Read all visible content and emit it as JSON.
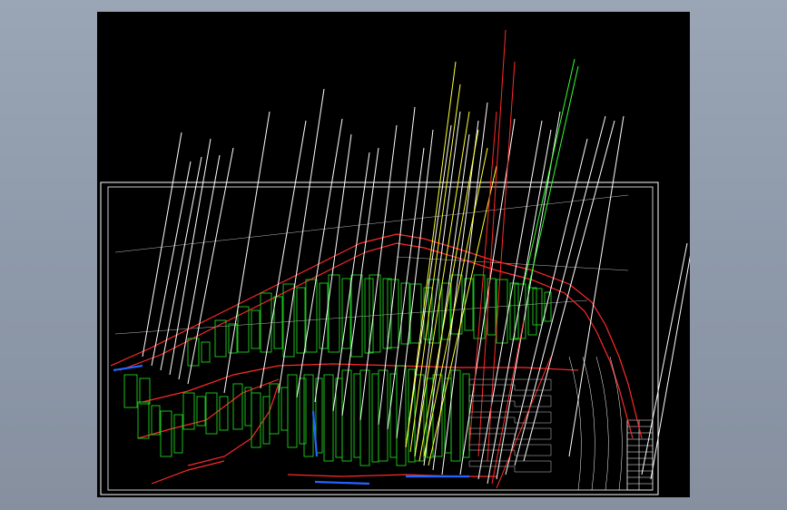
{
  "app": {
    "title": ""
  },
  "drawing": {
    "background": "#000000",
    "colors": {
      "frame": "#ffffff",
      "leader": "#ffffff",
      "road": "#ff2a2a",
      "building": "#1fd11f",
      "leader_yellow": "#ffff33",
      "leader_green": "#33ff33",
      "water": "#2266ff",
      "dim": "#bbbbbb"
    },
    "title_block_rows": 11
  }
}
